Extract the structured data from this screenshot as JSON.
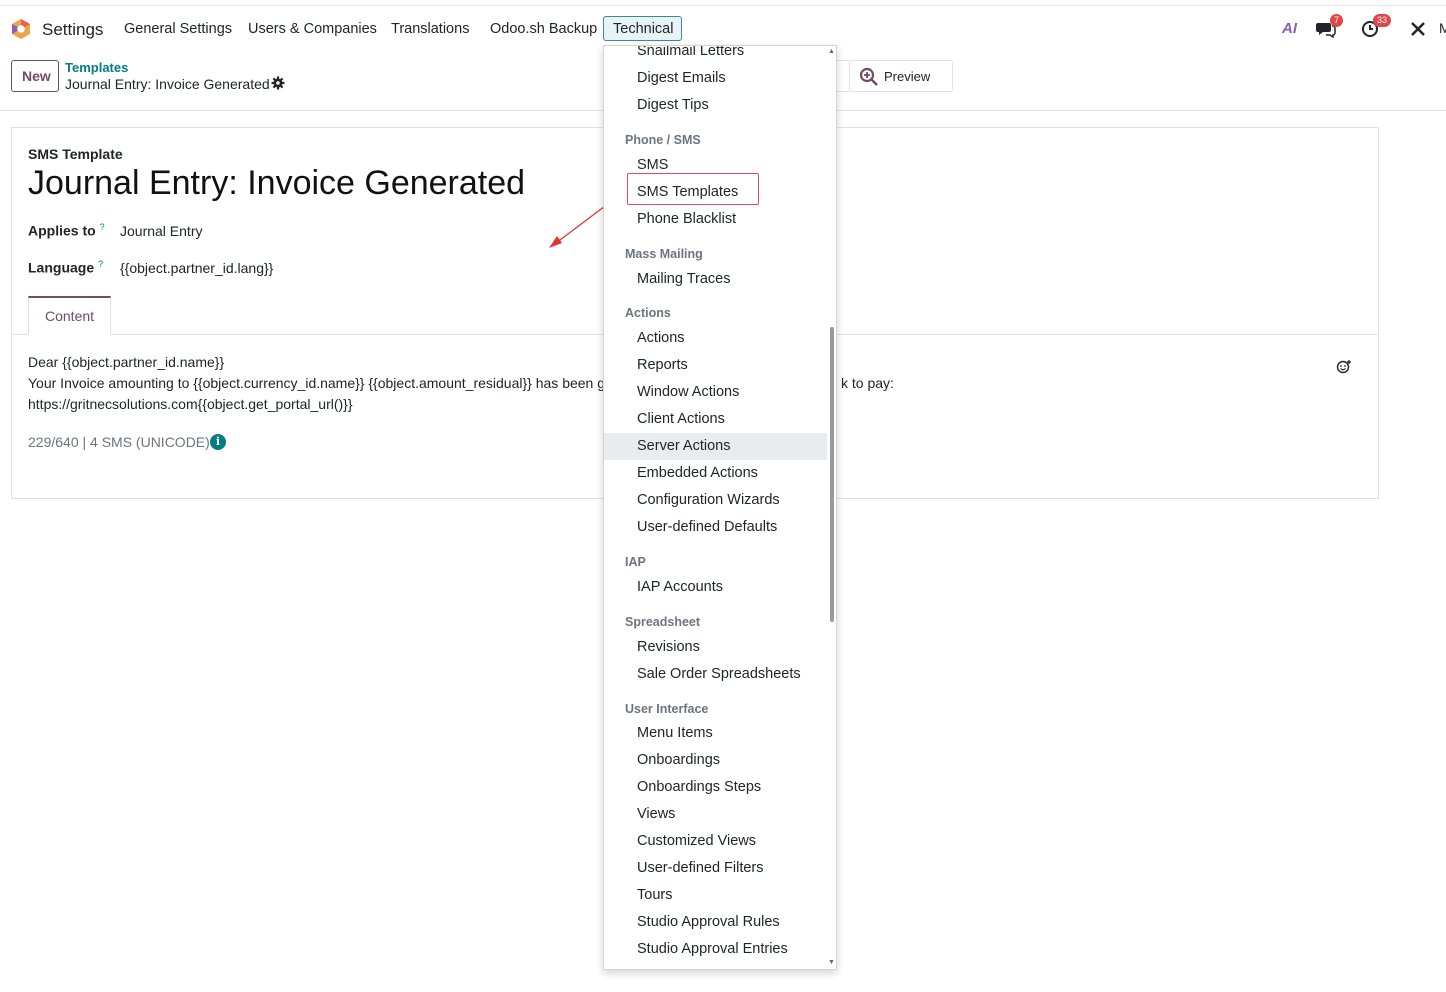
{
  "navbar": {
    "app_title": "Settings",
    "menus": [
      "General Settings",
      "Users & Companies",
      "Translations",
      "Odoo.sh Backup"
    ],
    "active_menu": "Technical",
    "ai_label": "AI",
    "messages_count": "7",
    "activities_count": "33",
    "user_initial": "M"
  },
  "control_panel": {
    "new_label": "New",
    "breadcrumb_parent": "Templates",
    "breadcrumb_current": "Journal Entry: Invoice Generated",
    "preview_label": "Preview"
  },
  "form": {
    "model_label": "SMS Template",
    "title": "Journal Entry: Invoice Generated",
    "applies_to_label": "Applies to",
    "applies_to_value": "Journal Entry",
    "language_label": "Language",
    "language_value": "{{object.partner_id.lang}}",
    "tab_content": "Content",
    "body_line1": "Dear {{object.partner_id.name}}",
    "body_line2_left": "Your Invoice amounting to {{object.currency_id.name}} {{object.amount_residual}} has been g",
    "body_line2_right": "k to pay:",
    "body_line3": "https://gritnecsolutions.com{{object.get_portal_url()}}",
    "counter": "229/640  | 4 SMS (UNICODE)",
    "help_mark": "?"
  },
  "dropdown": {
    "items": [
      {
        "type": "item",
        "label": "Snailmail Letters"
      },
      {
        "type": "item",
        "label": "Digest Emails"
      },
      {
        "type": "item",
        "label": "Digest Tips"
      },
      {
        "type": "header",
        "label": "Phone / SMS"
      },
      {
        "type": "item",
        "label": "SMS"
      },
      {
        "type": "item",
        "label": "SMS Templates"
      },
      {
        "type": "item",
        "label": "Phone Blacklist"
      },
      {
        "type": "header",
        "label": "Mass Mailing"
      },
      {
        "type": "item",
        "label": "Mailing Traces"
      },
      {
        "type": "header",
        "label": "Actions"
      },
      {
        "type": "item",
        "label": "Actions"
      },
      {
        "type": "item",
        "label": "Reports"
      },
      {
        "type": "item",
        "label": "Window Actions"
      },
      {
        "type": "item",
        "label": "Client Actions"
      },
      {
        "type": "item",
        "label": "Server Actions"
      },
      {
        "type": "item",
        "label": "Embedded Actions"
      },
      {
        "type": "item",
        "label": "Configuration Wizards"
      },
      {
        "type": "item",
        "label": "User-defined Defaults"
      },
      {
        "type": "header",
        "label": "IAP"
      },
      {
        "type": "item",
        "label": "IAP Accounts"
      },
      {
        "type": "header",
        "label": "Spreadsheet"
      },
      {
        "type": "item",
        "label": "Revisions"
      },
      {
        "type": "item",
        "label": "Sale Order Spreadsheets"
      },
      {
        "type": "header",
        "label": "User Interface"
      },
      {
        "type": "item",
        "label": "Menu Items"
      },
      {
        "type": "item",
        "label": "Onboardings"
      },
      {
        "type": "item",
        "label": "Onboardings Steps"
      },
      {
        "type": "item",
        "label": "Views"
      },
      {
        "type": "item",
        "label": "Customized Views"
      },
      {
        "type": "item",
        "label": "User-defined Filters"
      },
      {
        "type": "item",
        "label": "Tours"
      },
      {
        "type": "item",
        "label": "Studio Approval Rules"
      },
      {
        "type": "item",
        "label": "Studio Approval Entries"
      }
    ]
  },
  "colors": {
    "brand": "#714b67",
    "accent": "#017e84",
    "highlight": "#e24b5b"
  }
}
